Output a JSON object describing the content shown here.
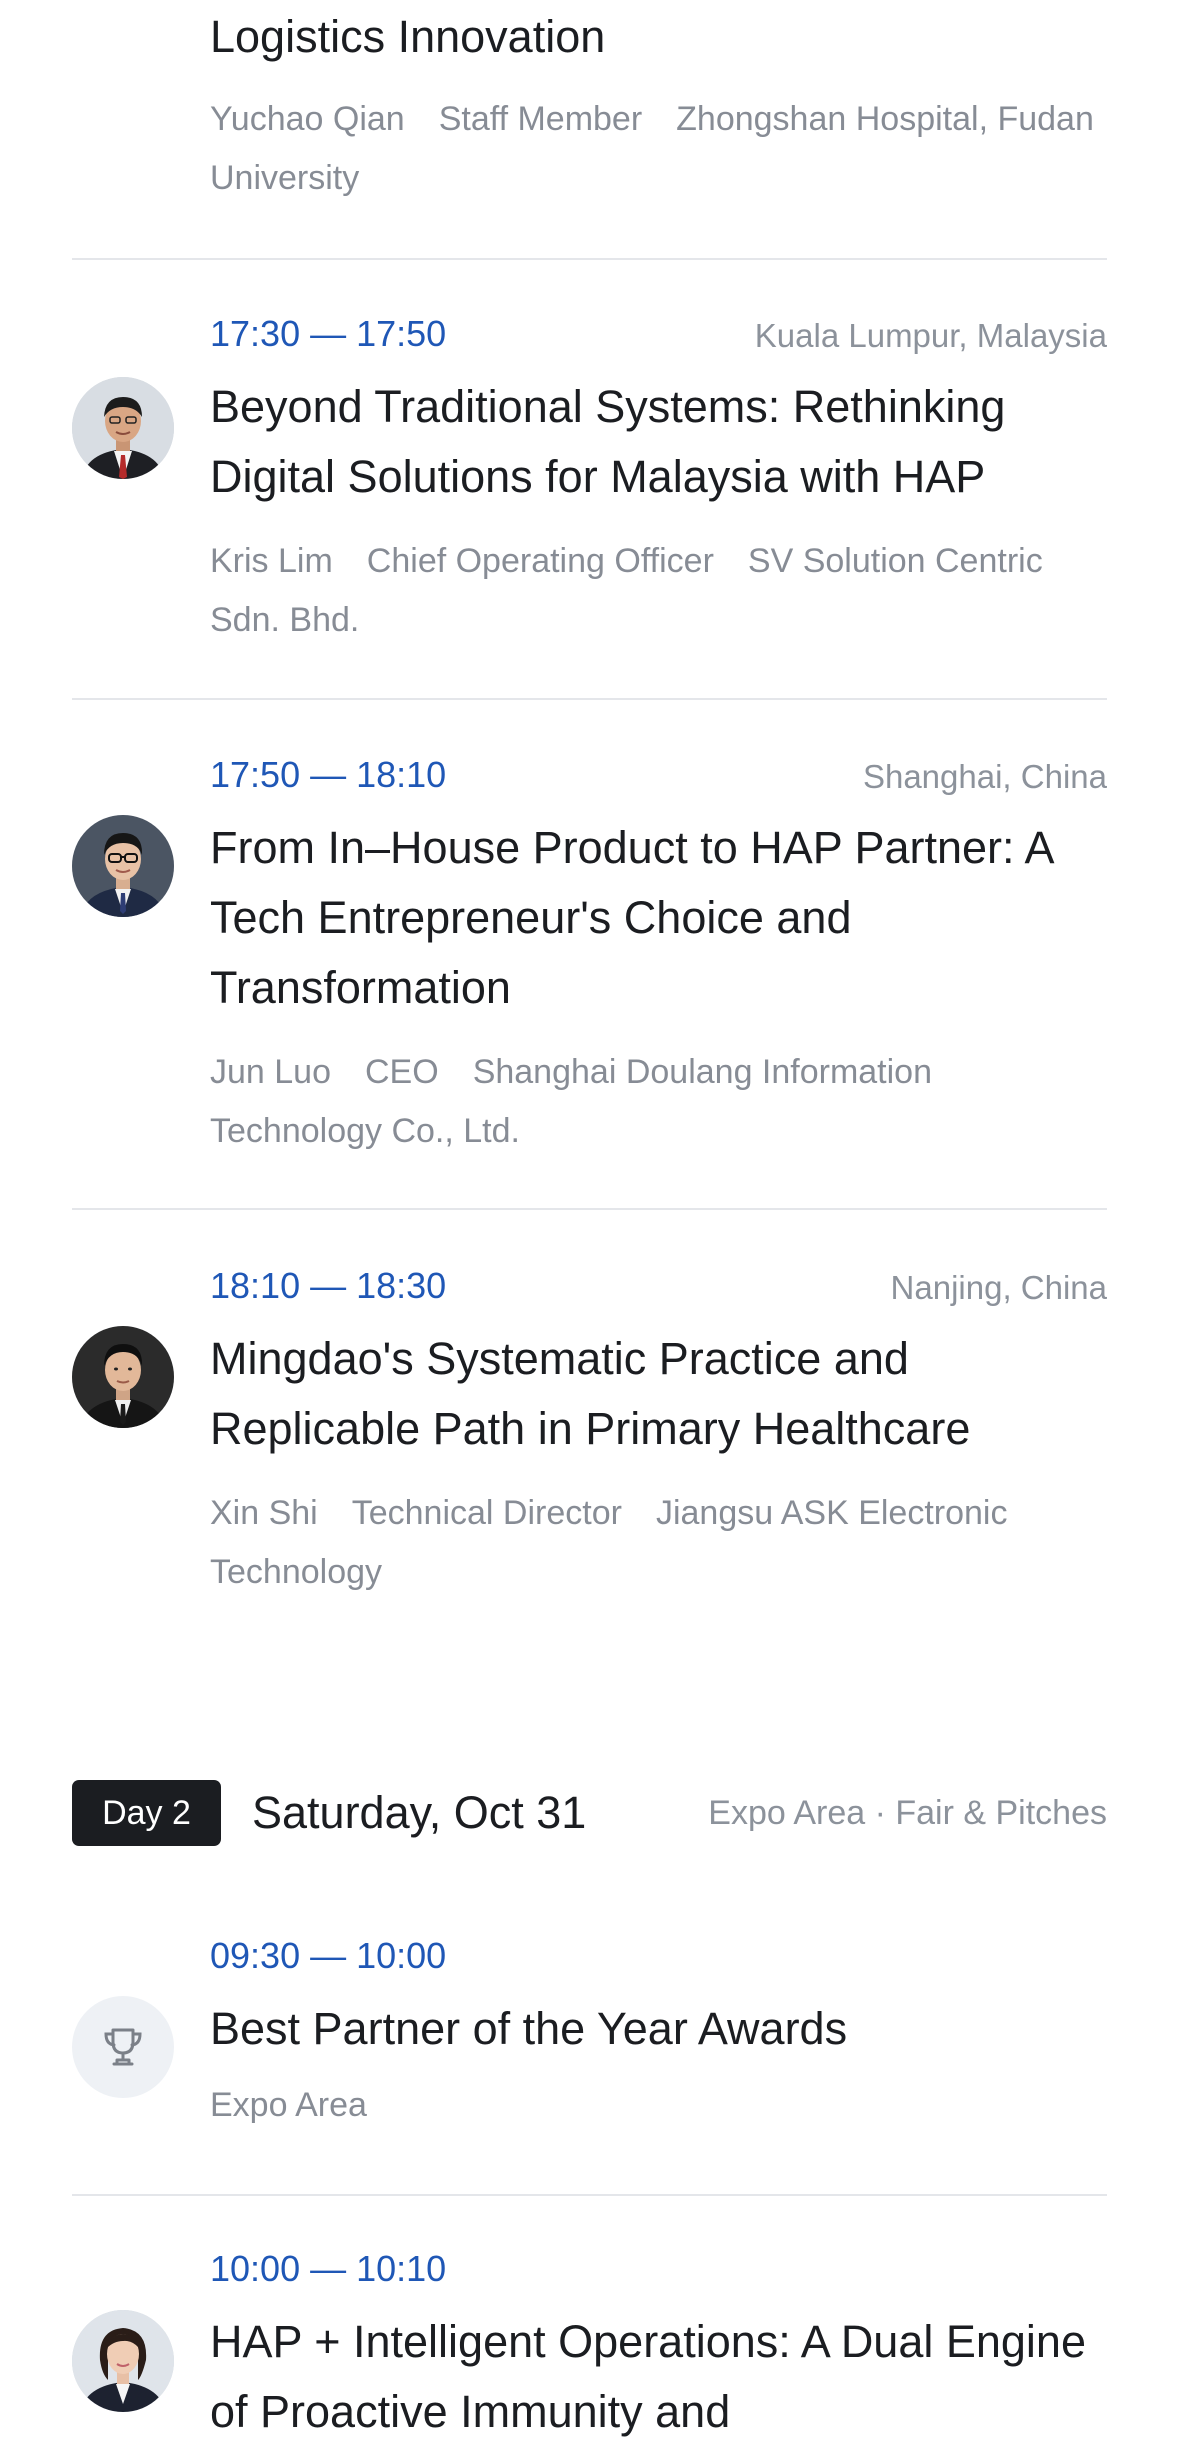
{
  "sessions": [
    {
      "title": "Logistics Innovation",
      "speaker": "Yuchao Qian",
      "role": "Staff Member",
      "org": "Zhongshan Hospital, Fudan University"
    },
    {
      "time": "17:30 — 17:50",
      "location": "Kuala Lumpur, Malaysia",
      "title": "Beyond Traditional Systems: Rethinking Digital Solutions for Malaysia with HAP",
      "speaker": "Kris Lim",
      "role": "Chief Operating Officer",
      "org": "SV Solution Centric Sdn. Bhd."
    },
    {
      "time": "17:50 — 18:10",
      "location": "Shanghai, China",
      "title": "From In–House Product to HAP Partner: A Tech Entrepreneur's Choice and Transformation",
      "speaker": "Jun Luo",
      "role": "CEO",
      "org": "Shanghai Doulang Information Technology Co., Ltd."
    },
    {
      "time": "18:10 — 18:30",
      "location": "Nanjing, China",
      "title": "Mingdao's Systematic Practice and Replicable Path in Primary Healthcare",
      "speaker": "Xin Shi",
      "role": "Technical Director",
      "org": "Jiangsu ASK Electronic Technology"
    }
  ],
  "day2": {
    "badge": "Day 2",
    "date": "Saturday, Oct 31",
    "area": "Expo Area · Fair & Pitches",
    "sessions": [
      {
        "time": "09:30 — 10:00",
        "title": "Best Partner of the Year Awards",
        "venue": "Expo Area",
        "icon": "trophy-icon"
      },
      {
        "time": "10:00 — 10:10",
        "title": "HAP + Intelligent Operations: A Dual Engine of Proactive Immunity and"
      }
    ]
  },
  "colors": {
    "time": "#1f57b6",
    "title": "#1b1d21",
    "meta": "#878c95",
    "divider": "#e4e6ea",
    "badge_bg": "#1b1d21"
  }
}
